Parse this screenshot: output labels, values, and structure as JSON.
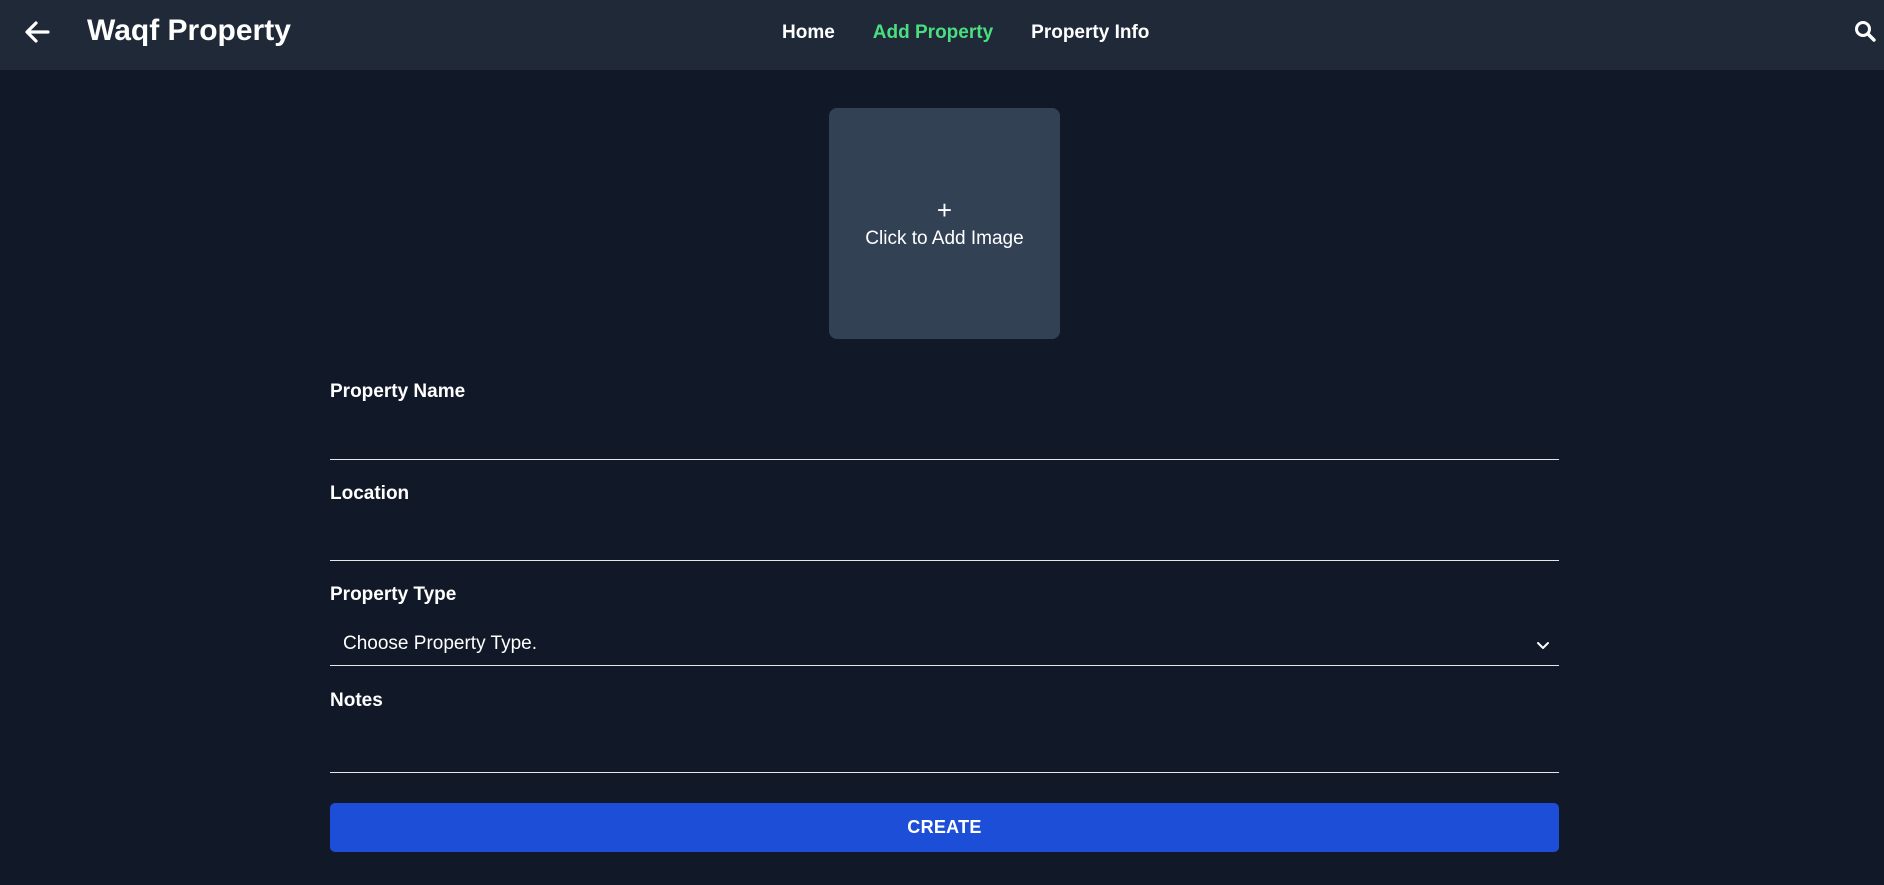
{
  "app": {
    "title": "Waqf Property",
    "back_icon": "arrow-left-icon",
    "search_icon": "search-icon"
  },
  "nav": {
    "items": [
      {
        "label": "Home",
        "active": false
      },
      {
        "label": "Add Property",
        "active": true
      },
      {
        "label": "Property Info",
        "active": false
      }
    ]
  },
  "image_upload": {
    "icon": "plus-icon",
    "plus_glyph": "+",
    "label": "Click to Add Image"
  },
  "form": {
    "property_name": {
      "label": "Property Name",
      "value": ""
    },
    "location": {
      "label": "Location",
      "value": ""
    },
    "property_type": {
      "label": "Property Type",
      "selected": "Choose Property Type.",
      "icon": "chevron-down-icon"
    },
    "notes": {
      "label": "Notes",
      "value": ""
    },
    "submit_label": "CREATE"
  },
  "colors": {
    "background": "#111827",
    "header": "#1f2937",
    "active_nav": "#4ade80",
    "upload_box": "#334155",
    "primary_button": "#1d4ed8"
  }
}
